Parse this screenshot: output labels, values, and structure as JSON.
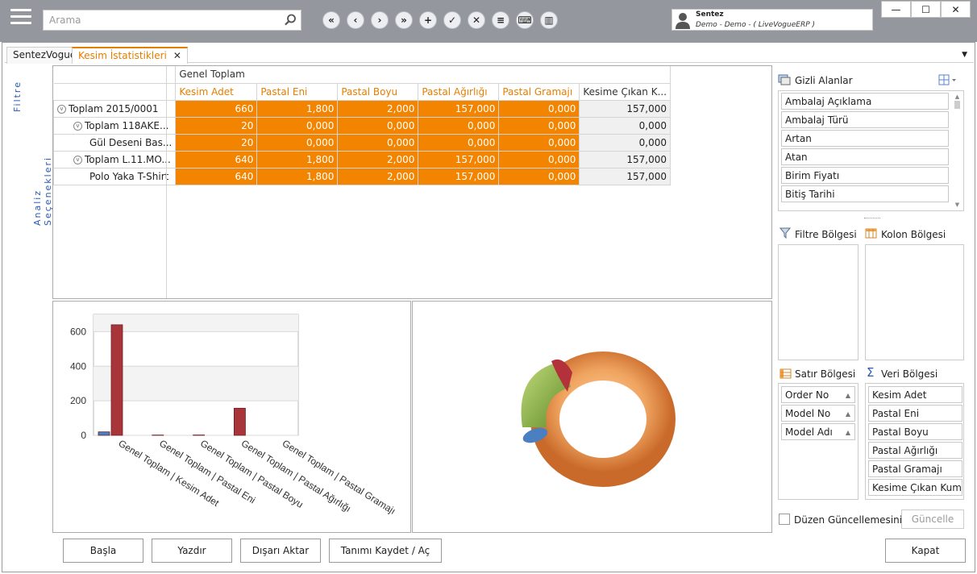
{
  "search": {
    "placeholder": "Arama"
  },
  "nav_buttons": [
    "first-icon",
    "prev-icon",
    "next-icon",
    "last-icon",
    "add-icon",
    "check-icon",
    "delete-icon",
    "menu-icon",
    "keyboard-icon",
    "trash-icon"
  ],
  "user": {
    "name": "Sentez",
    "detail": "Demo - Demo - ( LiveVogueERP )"
  },
  "window_buttons": {
    "minimize": "—",
    "maximize": "☐",
    "close": "✕"
  },
  "tabs": [
    {
      "label": "SentezVogue"
    },
    {
      "label": "Kesim İstatistikleri",
      "active": true
    }
  ],
  "left_vertical": {
    "filter": "Filtre",
    "analysis": "Analiz Seçenekleri"
  },
  "grid": {
    "group_header": "Genel Toplam",
    "columns": [
      "Kesim Adet",
      "Pastal Eni",
      "Pastal Boyu",
      "Pastal Ağırlığı",
      "Pastal Gramajı",
      "Kesime Çıkan K..."
    ],
    "rows": [
      {
        "label": "Toplam 2015/0001",
        "indent": 0,
        "expandable": true,
        "values": [
          "660",
          "1,800",
          "2,000",
          "157,000",
          "0,000",
          "157,000"
        ]
      },
      {
        "label": "Toplam 118AKE...",
        "indent": 1,
        "expandable": true,
        "values": [
          "20",
          "0,000",
          "0,000",
          "0,000",
          "0,000",
          "0,000"
        ]
      },
      {
        "label": "Gül Deseni Bas...",
        "indent": 2,
        "expandable": false,
        "values": [
          "20",
          "0,000",
          "0,000",
          "0,000",
          "0,000",
          "0,000"
        ]
      },
      {
        "label": "Toplam L.11.MO...",
        "indent": 1,
        "expandable": true,
        "values": [
          "640",
          "1,800",
          "2,000",
          "157,000",
          "0,000",
          "157,000"
        ]
      },
      {
        "label": "Polo Yaka T-Shirt",
        "indent": 2,
        "expandable": false,
        "values": [
          "640",
          "1,800",
          "2,000",
          "157,000",
          "0,000",
          "157,000"
        ]
      }
    ]
  },
  "chart_data": [
    {
      "type": "bar",
      "categories": [
        "Genel Toplam | Kesim Adet",
        "Genel Toplam | Pastal Eni",
        "Genel Toplam | Pastal Boyu",
        "Genel Toplam | Pastal Ağırlığı",
        "Genel Toplam | Pastal Gramajı"
      ],
      "series": [
        {
          "color": "#4a7fc1",
          "values": [
            20,
            0,
            0,
            0,
            0
          ]
        },
        {
          "color": "#a8353a",
          "values": [
            640,
            1.8,
            2,
            157,
            0
          ]
        }
      ],
      "yticks": [
        "0",
        "200",
        "400",
        "600"
      ],
      "ylim": [
        0,
        700
      ],
      "grid": true
    },
    {
      "type": "pie",
      "style": "3d-doughnut",
      "series": [
        {
          "color": "#f0a560",
          "values": [
            640
          ]
        },
        {
          "color": "#8db04a",
          "values": [
            20
          ]
        },
        {
          "color": "#4a7fc1",
          "values": [
            1
          ]
        },
        {
          "color": "#b3313a",
          "values": [
            1
          ]
        }
      ]
    }
  ],
  "side": {
    "hidden_fields_title": "Gizli Alanlar",
    "hidden_fields": [
      "Ambalaj Açıklama",
      "Ambalaj Türü",
      "Artan",
      "Atan",
      "Birim Fiyatı",
      "Bitiş Tarihi"
    ],
    "filter_area": "Filtre Bölgesi",
    "column_area": "Kolon Bölgesi",
    "row_area": "Satır Bölgesi",
    "data_area": "Veri Bölgesi",
    "row_fields": [
      "Order No",
      "Model No",
      "Model Adı"
    ],
    "data_fields": [
      "Kesim Adet",
      "Pastal Eni",
      "Pastal Boyu",
      "Pastal Ağırlığı",
      "Pastal Gramajı",
      "Kesime Çıkan Kumaş"
    ],
    "defer_label": "Düzen Güncellemesini Erte",
    "update_label": "Güncelle"
  },
  "footer": {
    "start": "Başla",
    "print": "Yazdır",
    "export": "Dışarı Aktar",
    "save": "Tanımı Kaydet  /  Aç",
    "close": "Kapat"
  },
  "colors": {
    "accent": "#e67e00",
    "cell": "#f28400",
    "titlebar": "#94979e"
  }
}
